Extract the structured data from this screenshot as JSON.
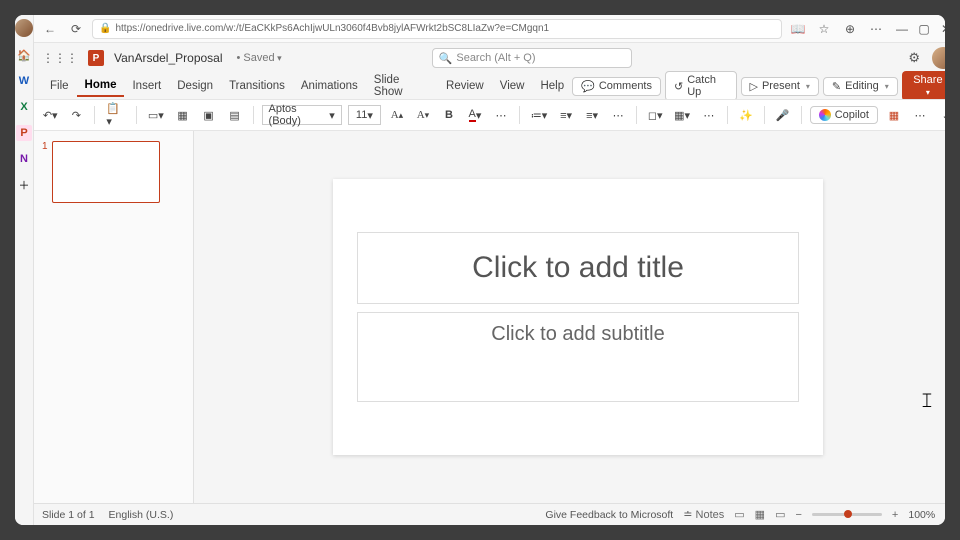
{
  "browser": {
    "url": "https://onedrive.live.com/w:/t/EaCKkPs6AchIjwULn3060f4Bvb8jylAFWrkt2bSC8LIaZw?e=CMgqn1"
  },
  "titlebar": {
    "doc_name": "VanArsdel_Proposal",
    "saved_label": "• Saved",
    "search_placeholder": "Search (Alt + Q)"
  },
  "menu": {
    "tabs": [
      "File",
      "Home",
      "Insert",
      "Design",
      "Transitions",
      "Animations",
      "Slide Show",
      "Review",
      "View",
      "Help"
    ],
    "active": "Home",
    "comments": "Comments",
    "catchup": "Catch Up",
    "present": "Present",
    "editing": "Editing",
    "share": "Share"
  },
  "ribbon": {
    "font_name": "Aptos (Body)",
    "font_size": "11",
    "copilot": "Copilot"
  },
  "slide": {
    "title_placeholder": "Click to add title",
    "subtitle_placeholder": "Click to add subtitle",
    "thumb_number": "1"
  },
  "status": {
    "slide_info": "Slide 1 of 1",
    "language": "English (U.S.)",
    "feedback": "Give Feedback to Microsoft",
    "notes": "Notes",
    "zoom": "100%"
  }
}
